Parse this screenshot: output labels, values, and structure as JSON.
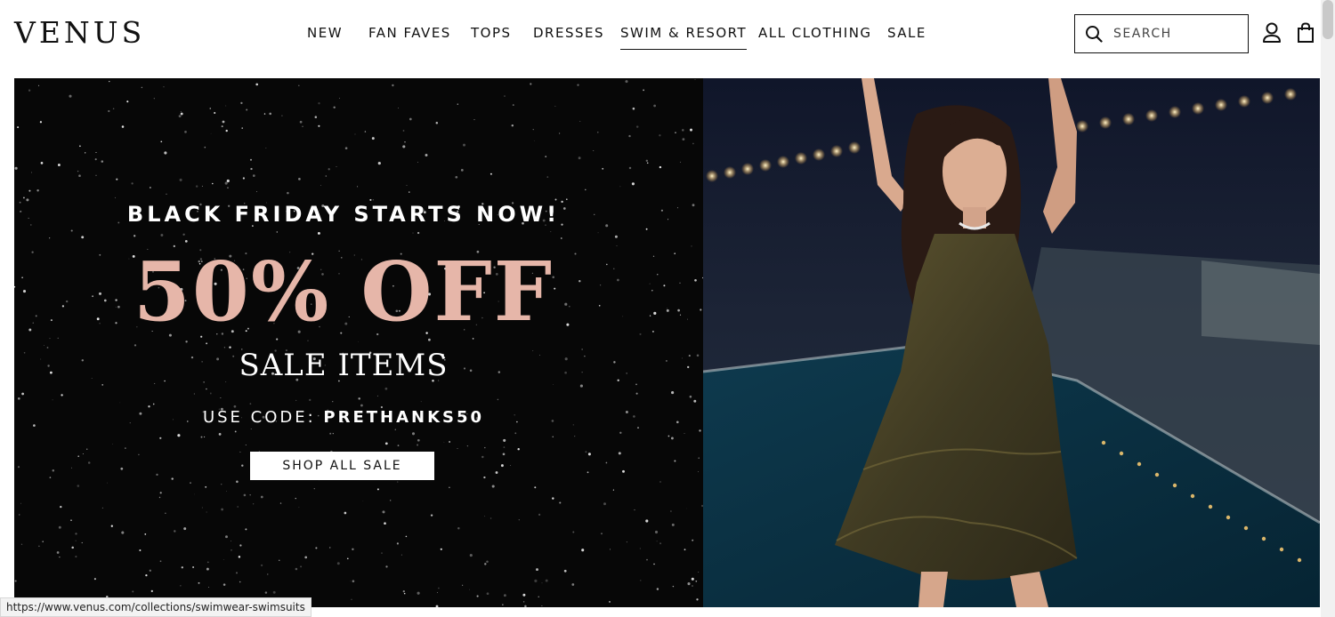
{
  "header": {
    "logo": "VENUS",
    "nav": [
      {
        "label": "NEW"
      },
      {
        "label": "FAN FAVES"
      },
      {
        "label": "TOPS"
      },
      {
        "label": "DRESSES"
      },
      {
        "label": "SWIM & RESORT",
        "active": true
      },
      {
        "label": "ALL CLOTHING"
      },
      {
        "label": "SALE"
      }
    ],
    "search_placeholder": "SEARCH",
    "icons": [
      "search-icon",
      "account-icon",
      "shopping-bag-icon"
    ]
  },
  "hero": {
    "kicker": "BLACK FRIDAY STARTS NOW!",
    "headline": "50% OFF",
    "subheadline": "SALE ITEMS",
    "code_label": "USE CODE:",
    "code": "PRETHANKS50",
    "cta": "SHOP ALL SALE",
    "colors": {
      "panel": "#070707",
      "accent": "#e6b6a9",
      "text": "#ffffff"
    }
  },
  "status_bar": {
    "url": "https://www.venus.com/collections/swimwear-swimsuits"
  }
}
